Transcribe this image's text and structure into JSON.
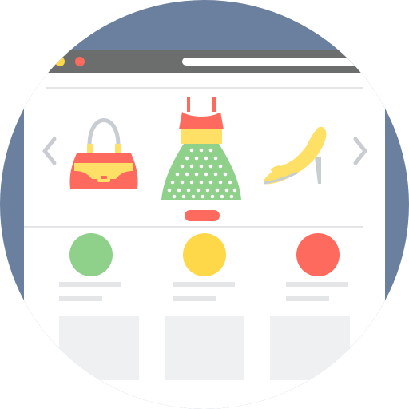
{
  "colors": {
    "background_circle": "#6b7f9f",
    "browser_chrome": "#6b6e6d",
    "window_body": "#ffffff",
    "divider": "#e3e5e7",
    "placeholder_line": "#e3e5e7",
    "placeholder_card": "#eef0f1",
    "nav_arrow": "#c9cdd1",
    "dot_green": "#8fd08a",
    "dot_yellow": "#ffd84a",
    "dot_red": "#ff6a5e",
    "url_bar": "#ffffff"
  },
  "window": {
    "dots": [
      "green-dot-icon",
      "yellow-dot-icon",
      "red-dot-icon"
    ]
  },
  "carousel": {
    "prev_icon": "chevron-left-icon",
    "next_icon": "chevron-right-icon",
    "items": [
      {
        "icon": "handbag-icon",
        "colors": [
          "#ff6a5e",
          "#ffe066",
          "#c8cdd2"
        ]
      },
      {
        "icon": "polka-dot-dress-icon",
        "colors": [
          "#ff6a5e",
          "#ffe066",
          "#8fd08a",
          "#ffffff"
        ]
      },
      {
        "icon": "high-heel-shoe-icon",
        "colors": [
          "#ffe066",
          "#c8cdd2"
        ]
      }
    ],
    "indicator_color": "#ff6a5e"
  },
  "products": [
    {
      "swatch": "#8fd08a"
    },
    {
      "swatch": "#ffd84a"
    },
    {
      "swatch": "#ff6a5e"
    }
  ]
}
